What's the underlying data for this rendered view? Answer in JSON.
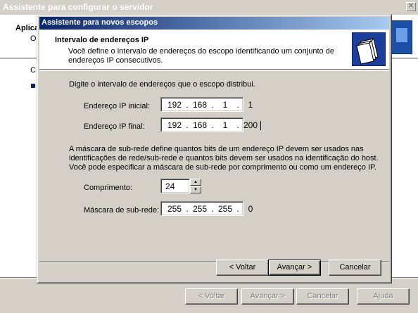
{
  "background_window": {
    "title": "Assistente para configurar o servidor",
    "header_title_fragment": "Aplica",
    "header_sub_fragment": "O",
    "side_fragment": "C",
    "buttons": {
      "back": "< Voltar",
      "next": "Avançar >",
      "cancel": "Cancelar",
      "help": "Ajuda"
    }
  },
  "dialog": {
    "title": "Assistente para novos escopos",
    "header": {
      "title": "Intervalo de endereços IP",
      "description": "Você define o intervalo de endereços do escopo identificando um conjunto de endereços IP consecutivos."
    },
    "instruction": "Digite o intervalo de endereços que o escopo distribui.",
    "start_ip": {
      "label": "Endereço IP inicial:",
      "octets": [
        "192",
        "168",
        "1",
        "1"
      ]
    },
    "end_ip": {
      "label": "Endereço IP final:",
      "octets": [
        "192",
        "168",
        "1",
        "200"
      ]
    },
    "mask_description": "A máscara de sub-rede define quantos bits de um endereço IP devem ser usados nas identificações de rede/sub-rede e quantos bits devem ser usados na identificação do host. Você pode especificar a máscara de sub-rede por comprimento ou como um endereço IP.",
    "length": {
      "label": "Comprimento:",
      "value": "24"
    },
    "subnet_mask": {
      "label": "Máscara de sub-rede:",
      "octets": [
        "255",
        "255",
        "255",
        "0"
      ]
    },
    "buttons": {
      "back": "< Voltar",
      "next": "Avançar >",
      "cancel": "Cancelar"
    }
  },
  "colors": {
    "title_active_start": "#0a246a",
    "title_active_end": "#a6caf0",
    "face": "#d4d0c8"
  }
}
